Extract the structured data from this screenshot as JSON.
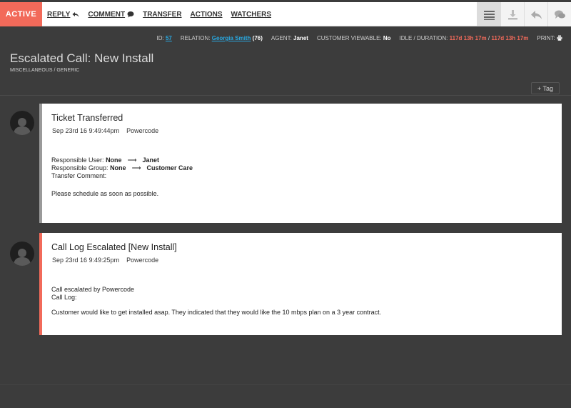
{
  "topbar": {
    "status": "ACTIVE",
    "menu": [
      {
        "label": "REPLY",
        "icon": "reply-icon"
      },
      {
        "label": "COMMENT",
        "icon": "comment-icon"
      },
      {
        "label": "TRANSFER"
      },
      {
        "label": "ACTIONS"
      },
      {
        "label": "WATCHERS"
      }
    ],
    "tools": [
      {
        "icon": "list-icon",
        "active": true
      },
      {
        "icon": "download-icon"
      },
      {
        "icon": "reply-icon"
      },
      {
        "icon": "comments-icon"
      }
    ]
  },
  "info": {
    "id_label": "ID:",
    "id_value": "57",
    "relation_label": "RELATION:",
    "relation_name": "Georgia Smith",
    "relation_count": "(76)",
    "agent_label": "AGENT:",
    "agent_value": "Janet",
    "viewable_label": "CUSTOMER VIEWABLE:",
    "viewable_value": "No",
    "idle_label": "IDLE / DURATION:",
    "idle_value": "117d 13h 17m",
    "slash": "/",
    "duration_value": "117d 13h 17m",
    "print_label": "PRINT:"
  },
  "header": {
    "title": "Escalated Call: New Install",
    "subtitle": "MISCELLANEOUS / GENERIC",
    "tag_button": "+ Tag"
  },
  "entries": [
    {
      "title": "Ticket Transferred",
      "date": "Sep 23rd 16 9:49:44pm",
      "author": "Powercode",
      "user_label": "Responsible User:",
      "user_from": "None",
      "user_to": "Janet",
      "group_label": "Responsible Group:",
      "group_from": "None",
      "group_to": "Customer Care",
      "comment_label": "Transfer Comment:",
      "comment": "Please schedule as soon as possible."
    },
    {
      "title": "Call Log Escalated [New Install]",
      "date": "Sep 23rd 16 9:49:25pm",
      "author": "Powercode",
      "line1": "Call escalated by Powercode",
      "line2": "Call Log:",
      "comment": "Customer would like to get installed asap. They indicated that they would like the 10 mbps plan on a 3 year contract."
    }
  ],
  "colors": {
    "accent": "#f26a5a",
    "link": "#29a8e0",
    "background": "#3c3c3c"
  }
}
